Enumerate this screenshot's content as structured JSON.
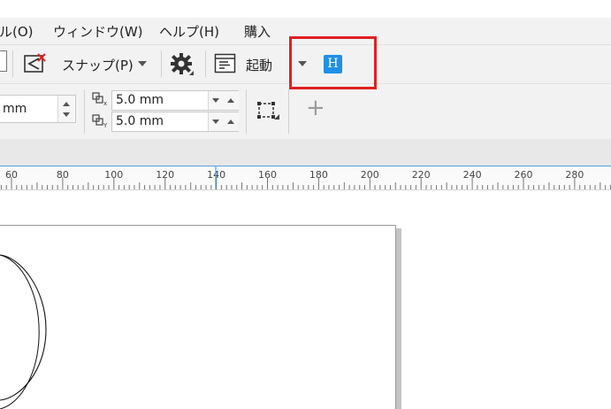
{
  "menubar": {
    "items": [
      {
        "label": "ル(O)"
      },
      {
        "label": "ウィンドウ(W)"
      },
      {
        "label": "ヘルプ(H)"
      },
      {
        "label": "購入"
      }
    ]
  },
  "toolbar": {
    "snap_label": "スナップ(P)",
    "launch_label": "起動",
    "h_badge": "H"
  },
  "propertybar": {
    "partial_value": "mm",
    "nudge_x": "5.0 mm",
    "nudge_y": "5.0 mm",
    "plus_label": "+"
  },
  "ruler": {
    "ticks": [
      "60",
      "80",
      "100",
      "120",
      "140",
      "160",
      "180",
      "200",
      "220",
      "240",
      "260",
      "280"
    ]
  },
  "colors": {
    "highlight": "#e02020",
    "h_badge_bg": "#1e90e8",
    "accent_line": "#5aa0dc"
  },
  "icons": {
    "snap_off": "snap-off-icon",
    "settings": "gear-icon",
    "launch": "launch-window-icon",
    "transform": "transform-frame-icon",
    "nudge": "nudge-icon"
  }
}
